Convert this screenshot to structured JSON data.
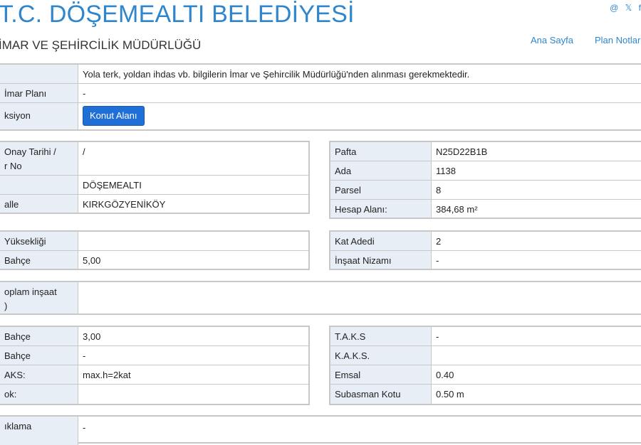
{
  "header": {
    "title": "T.C. DÖŞEMEALTI BELEDİYESİ",
    "subtitle": "İMAR VE ŞEHİRCİLİK MÜDÜRLÜĞÜ",
    "social": [
      "@",
      "🐦",
      "f"
    ],
    "nav": [
      "Ana Sayfa",
      "Plan Notları"
    ]
  },
  "top": {
    "notice": "Yola terk, yoldan ihdas vb. bilgilerin İmar ve Şehircilik Müdürlüğü'nden alınması gerekmektedir.",
    "plan_label": "İmar Planı",
    "plan_value": "-",
    "function_label": "ksiyon",
    "function_button": "Konut Alanı"
  },
  "location": {
    "approval_label_1": "Onay Tarihi /",
    "approval_label_2": "r No",
    "approval_value": "/",
    "district_value": "DÖŞEMEALTI",
    "mahalle_label": "alle",
    "mahalle_value": "KIRKGÖZYENİKÖY"
  },
  "parcel": {
    "rows": [
      {
        "label": "Pafta",
        "value": "N25D22B1B"
      },
      {
        "label": "Ada",
        "value": "1138"
      },
      {
        "label": "Parsel",
        "value": "8"
      },
      {
        "label": "Hesap Alanı:",
        "value": "384,68 m²"
      }
    ]
  },
  "height": {
    "yukseklik_label": "Yüksekliği",
    "yukseklik_value": "",
    "bahce_label": "Bahçe",
    "bahce_value": "5,00"
  },
  "floors": {
    "rows": [
      {
        "label": "Kat Adedi",
        "value": "2"
      },
      {
        "label": "İnşaat Nizamı",
        "value": "-"
      }
    ]
  },
  "total": {
    "label_1": "oplam inşaat",
    "label_2": ")",
    "value": ""
  },
  "setbacks": {
    "rows": [
      {
        "label": "Bahçe",
        "value": "3,00"
      },
      {
        "label": "Bahçe",
        "value": "-"
      },
      {
        "label": "AKS:",
        "value": "max.h=2kat"
      },
      {
        "label": "ok:",
        "value": ""
      }
    ]
  },
  "ratios": {
    "rows": [
      {
        "label": "T.A.K.S",
        "value": "-"
      },
      {
        "label": "K.A.K.S.",
        "value": ""
      },
      {
        "label": "Emsal",
        "value": "0.40"
      },
      {
        "label": "Subasman Kotu",
        "value": "0.50 m"
      }
    ]
  },
  "bottom": {
    "label": "ıklama",
    "value": "-"
  }
}
